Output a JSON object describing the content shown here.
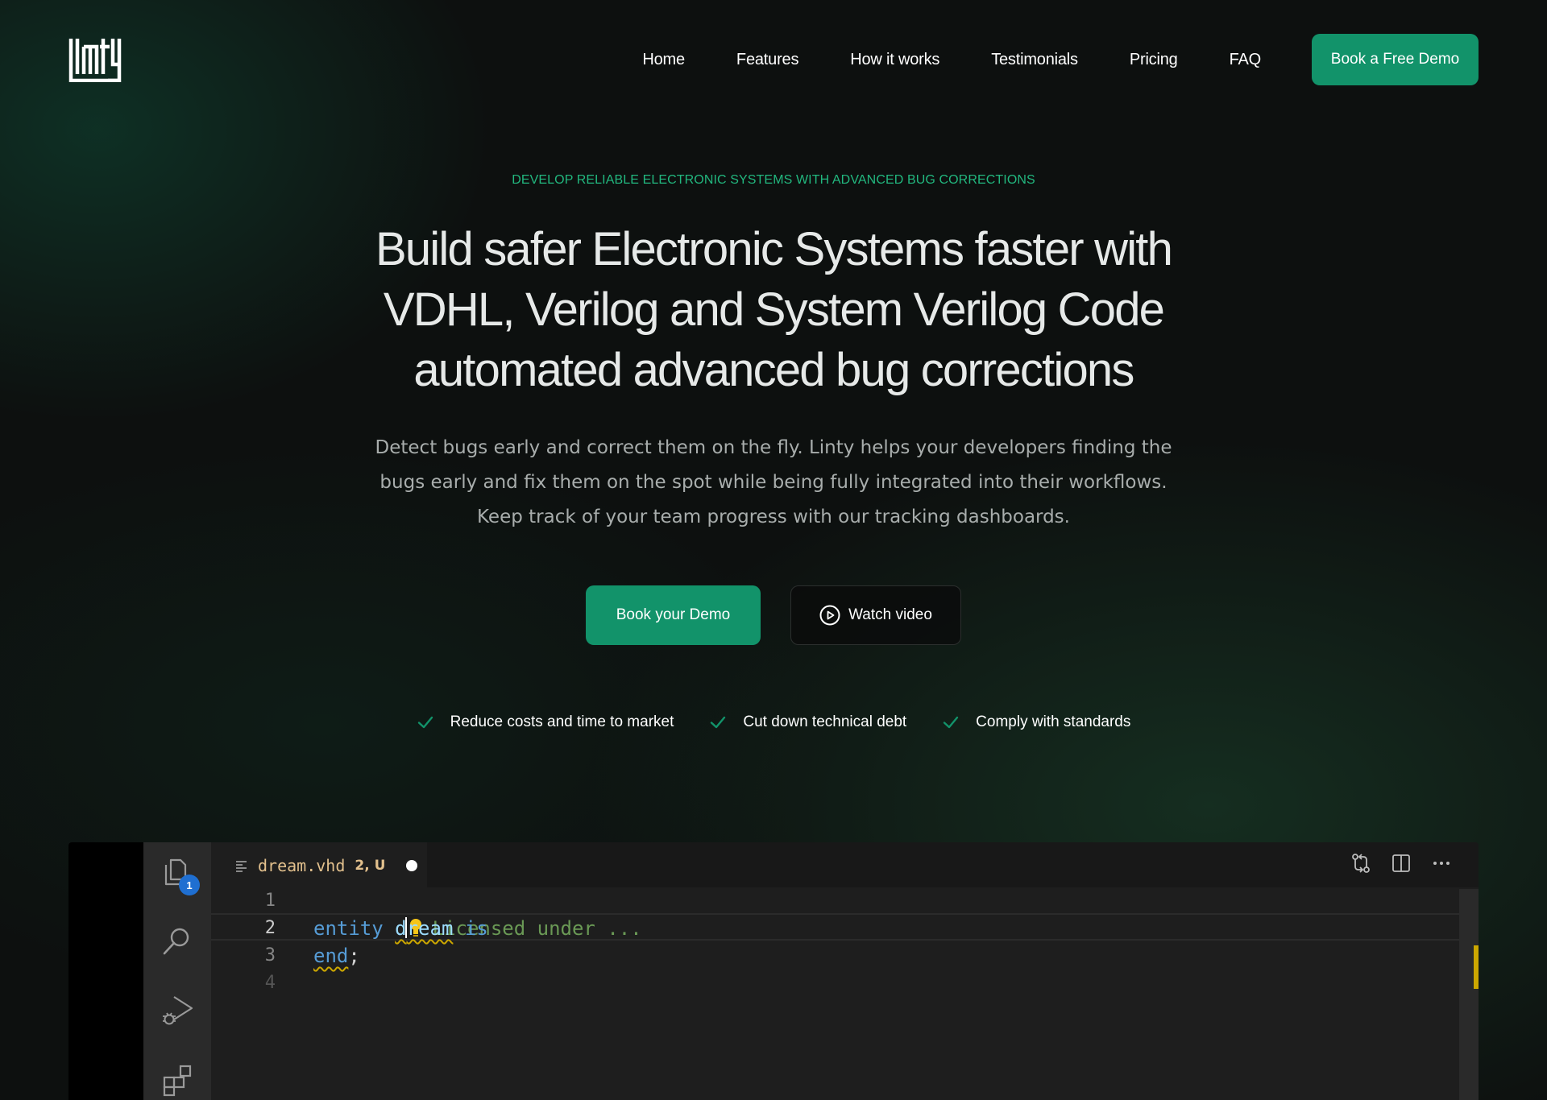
{
  "brand": {
    "logo_text": "Linty",
    "accent": "#12936a",
    "eyebrow_color": "#22b87f"
  },
  "nav": {
    "links": [
      "Home",
      "Features",
      "How it works",
      "Testimonials",
      "Pricing",
      "FAQ"
    ],
    "cta": "Book a Free Demo"
  },
  "hero": {
    "eyebrow": "DEVELOP RELIABLE ELECTRONIC SYSTEMS WITH ADVANCED BUG CORRECTIONS",
    "headline_lines": [
      "Build safer Electronic Systems faster  with",
      "VDHL, Verilog and System Verilog Code",
      "automated advanced bug corrections"
    ],
    "subtext_lines": [
      "Detect bugs early and correct them on the fly. Linty helps your developers finding the",
      "bugs early and fix them on the spot while being fully integrated into their workflows.",
      "Keep track of your team progress with our tracking dashboards."
    ],
    "primary_button": "Book your Demo",
    "secondary_button": "Watch video",
    "secondary_icon": "play-circle-icon"
  },
  "features": [
    {
      "icon": "check-icon",
      "label": "Reduce costs and time to market"
    },
    {
      "icon": "check-icon",
      "label": "Cut down technical debt"
    },
    {
      "icon": "check-icon",
      "label": "Comply with standards"
    }
  ],
  "editor": {
    "activity_icons": [
      "files-icon",
      "search-icon",
      "run-debug-icon",
      "extensions-icon"
    ],
    "explorer_badge": "1",
    "tab": {
      "filename": "dream.vhd",
      "status": "2, U",
      "modified_dot": true
    },
    "actions": [
      "compare-changes-icon",
      "split-editor-icon",
      "more-actions-icon"
    ],
    "lines": [
      {
        "number": "1",
        "tokens": [
          {
            "t": "Licensed under ...",
            "c": "comment"
          }
        ]
      },
      {
        "number": "2",
        "tokens": [
          {
            "t": "entity ",
            "c": "kw"
          },
          {
            "t": "d",
            "c": "ident squig"
          },
          {
            "t": "ream",
            "c": "ident squig"
          },
          {
            "t": " is",
            "c": "kw"
          }
        ]
      },
      {
        "number": "3",
        "tokens": [
          {
            "t": "end",
            "c": "kw squig"
          },
          {
            "t": ";",
            "c": "plain"
          }
        ]
      },
      {
        "number": "4",
        "tokens": []
      }
    ]
  }
}
